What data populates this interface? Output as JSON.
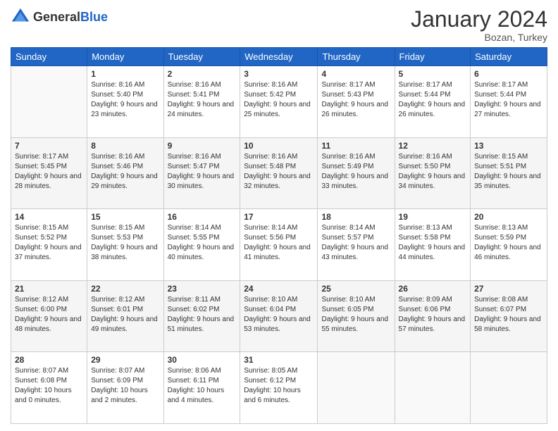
{
  "header": {
    "logo_general": "General",
    "logo_blue": "Blue",
    "month_title": "January 2024",
    "location": "Bozan, Turkey"
  },
  "days_of_week": [
    "Sunday",
    "Monday",
    "Tuesday",
    "Wednesday",
    "Thursday",
    "Friday",
    "Saturday"
  ],
  "weeks": [
    [
      {
        "day": "",
        "sunrise": "",
        "sunset": "",
        "daylight": ""
      },
      {
        "day": "1",
        "sunrise": "Sunrise: 8:16 AM",
        "sunset": "Sunset: 5:40 PM",
        "daylight": "Daylight: 9 hours and 23 minutes."
      },
      {
        "day": "2",
        "sunrise": "Sunrise: 8:16 AM",
        "sunset": "Sunset: 5:41 PM",
        "daylight": "Daylight: 9 hours and 24 minutes."
      },
      {
        "day": "3",
        "sunrise": "Sunrise: 8:16 AM",
        "sunset": "Sunset: 5:42 PM",
        "daylight": "Daylight: 9 hours and 25 minutes."
      },
      {
        "day": "4",
        "sunrise": "Sunrise: 8:17 AM",
        "sunset": "Sunset: 5:43 PM",
        "daylight": "Daylight: 9 hours and 26 minutes."
      },
      {
        "day": "5",
        "sunrise": "Sunrise: 8:17 AM",
        "sunset": "Sunset: 5:44 PM",
        "daylight": "Daylight: 9 hours and 26 minutes."
      },
      {
        "day": "6",
        "sunrise": "Sunrise: 8:17 AM",
        "sunset": "Sunset: 5:44 PM",
        "daylight": "Daylight: 9 hours and 27 minutes."
      }
    ],
    [
      {
        "day": "7",
        "sunrise": "Sunrise: 8:17 AM",
        "sunset": "Sunset: 5:45 PM",
        "daylight": "Daylight: 9 hours and 28 minutes."
      },
      {
        "day": "8",
        "sunrise": "Sunrise: 8:16 AM",
        "sunset": "Sunset: 5:46 PM",
        "daylight": "Daylight: 9 hours and 29 minutes."
      },
      {
        "day": "9",
        "sunrise": "Sunrise: 8:16 AM",
        "sunset": "Sunset: 5:47 PM",
        "daylight": "Daylight: 9 hours and 30 minutes."
      },
      {
        "day": "10",
        "sunrise": "Sunrise: 8:16 AM",
        "sunset": "Sunset: 5:48 PM",
        "daylight": "Daylight: 9 hours and 32 minutes."
      },
      {
        "day": "11",
        "sunrise": "Sunrise: 8:16 AM",
        "sunset": "Sunset: 5:49 PM",
        "daylight": "Daylight: 9 hours and 33 minutes."
      },
      {
        "day": "12",
        "sunrise": "Sunrise: 8:16 AM",
        "sunset": "Sunset: 5:50 PM",
        "daylight": "Daylight: 9 hours and 34 minutes."
      },
      {
        "day": "13",
        "sunrise": "Sunrise: 8:15 AM",
        "sunset": "Sunset: 5:51 PM",
        "daylight": "Daylight: 9 hours and 35 minutes."
      }
    ],
    [
      {
        "day": "14",
        "sunrise": "Sunrise: 8:15 AM",
        "sunset": "Sunset: 5:52 PM",
        "daylight": "Daylight: 9 hours and 37 minutes."
      },
      {
        "day": "15",
        "sunrise": "Sunrise: 8:15 AM",
        "sunset": "Sunset: 5:53 PM",
        "daylight": "Daylight: 9 hours and 38 minutes."
      },
      {
        "day": "16",
        "sunrise": "Sunrise: 8:14 AM",
        "sunset": "Sunset: 5:55 PM",
        "daylight": "Daylight: 9 hours and 40 minutes."
      },
      {
        "day": "17",
        "sunrise": "Sunrise: 8:14 AM",
        "sunset": "Sunset: 5:56 PM",
        "daylight": "Daylight: 9 hours and 41 minutes."
      },
      {
        "day": "18",
        "sunrise": "Sunrise: 8:14 AM",
        "sunset": "Sunset: 5:57 PM",
        "daylight": "Daylight: 9 hours and 43 minutes."
      },
      {
        "day": "19",
        "sunrise": "Sunrise: 8:13 AM",
        "sunset": "Sunset: 5:58 PM",
        "daylight": "Daylight: 9 hours and 44 minutes."
      },
      {
        "day": "20",
        "sunrise": "Sunrise: 8:13 AM",
        "sunset": "Sunset: 5:59 PM",
        "daylight": "Daylight: 9 hours and 46 minutes."
      }
    ],
    [
      {
        "day": "21",
        "sunrise": "Sunrise: 8:12 AM",
        "sunset": "Sunset: 6:00 PM",
        "daylight": "Daylight: 9 hours and 48 minutes."
      },
      {
        "day": "22",
        "sunrise": "Sunrise: 8:12 AM",
        "sunset": "Sunset: 6:01 PM",
        "daylight": "Daylight: 9 hours and 49 minutes."
      },
      {
        "day": "23",
        "sunrise": "Sunrise: 8:11 AM",
        "sunset": "Sunset: 6:02 PM",
        "daylight": "Daylight: 9 hours and 51 minutes."
      },
      {
        "day": "24",
        "sunrise": "Sunrise: 8:10 AM",
        "sunset": "Sunset: 6:04 PM",
        "daylight": "Daylight: 9 hours and 53 minutes."
      },
      {
        "day": "25",
        "sunrise": "Sunrise: 8:10 AM",
        "sunset": "Sunset: 6:05 PM",
        "daylight": "Daylight: 9 hours and 55 minutes."
      },
      {
        "day": "26",
        "sunrise": "Sunrise: 8:09 AM",
        "sunset": "Sunset: 6:06 PM",
        "daylight": "Daylight: 9 hours and 57 minutes."
      },
      {
        "day": "27",
        "sunrise": "Sunrise: 8:08 AM",
        "sunset": "Sunset: 6:07 PM",
        "daylight": "Daylight: 9 hours and 58 minutes."
      }
    ],
    [
      {
        "day": "28",
        "sunrise": "Sunrise: 8:07 AM",
        "sunset": "Sunset: 6:08 PM",
        "daylight": "Daylight: 10 hours and 0 minutes."
      },
      {
        "day": "29",
        "sunrise": "Sunrise: 8:07 AM",
        "sunset": "Sunset: 6:09 PM",
        "daylight": "Daylight: 10 hours and 2 minutes."
      },
      {
        "day": "30",
        "sunrise": "Sunrise: 8:06 AM",
        "sunset": "Sunset: 6:11 PM",
        "daylight": "Daylight: 10 hours and 4 minutes."
      },
      {
        "day": "31",
        "sunrise": "Sunrise: 8:05 AM",
        "sunset": "Sunset: 6:12 PM",
        "daylight": "Daylight: 10 hours and 6 minutes."
      },
      {
        "day": "",
        "sunrise": "",
        "sunset": "",
        "daylight": ""
      },
      {
        "day": "",
        "sunrise": "",
        "sunset": "",
        "daylight": ""
      },
      {
        "day": "",
        "sunrise": "",
        "sunset": "",
        "daylight": ""
      }
    ]
  ]
}
